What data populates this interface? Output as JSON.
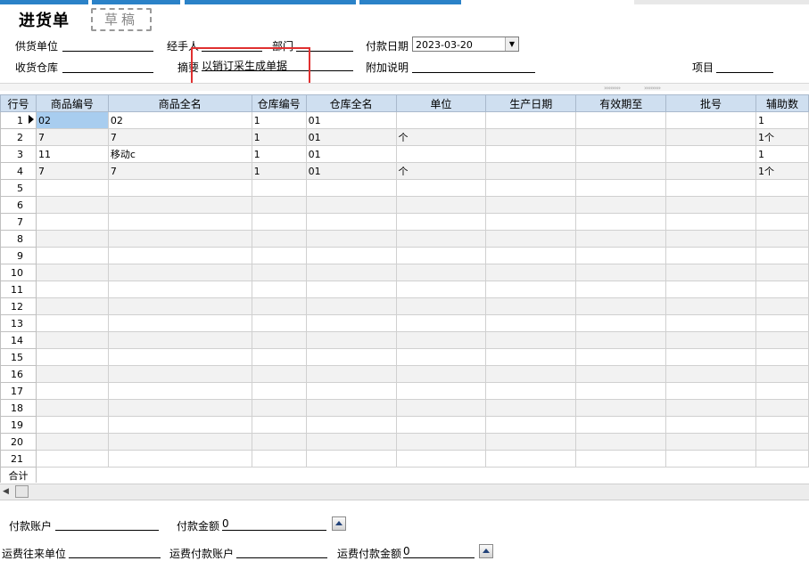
{
  "header": {
    "title": "进货单",
    "stamp": "草稿"
  },
  "form": {
    "supplier_label": "供货单位",
    "supplier_value": "",
    "handler_label": "经手人",
    "handler_value": "",
    "dept_label": "部门",
    "dept_value": "",
    "paydate_label": "付款日期",
    "paydate_value": "2023-03-20",
    "warehouse_label": "收货仓库",
    "warehouse_value": "",
    "summary_label": "摘要",
    "summary_value": "以销订采生成单据",
    "extra_label": "附加说明",
    "extra_value": "",
    "project_label": "项目",
    "project_value": ""
  },
  "grid": {
    "columns": [
      "行号",
      "商品编号",
      "商品全名",
      "仓库编号",
      "仓库全名",
      "单位",
      "生产日期",
      "有效期至",
      "批号",
      "辅助数"
    ],
    "rows": [
      {
        "no": "1",
        "code": "02",
        "name": "02",
        "wh_code": "1",
        "wh_name": "01",
        "unit": "",
        "mfg": "",
        "exp": "",
        "batch": "",
        "aux": "1"
      },
      {
        "no": "2",
        "code": "7",
        "name": "7",
        "wh_code": "1",
        "wh_name": "01",
        "unit": "个",
        "mfg": "",
        "exp": "",
        "batch": "",
        "aux": "1个"
      },
      {
        "no": "3",
        "code": "11",
        "name": "移动c",
        "wh_code": "1",
        "wh_name": "01",
        "unit": "",
        "mfg": "",
        "exp": "",
        "batch": "",
        "aux": "1"
      },
      {
        "no": "4",
        "code": "7",
        "name": "7",
        "wh_code": "1",
        "wh_name": "01",
        "unit": "个",
        "mfg": "",
        "exp": "",
        "batch": "",
        "aux": "1个"
      },
      {
        "no": "5"
      },
      {
        "no": "6"
      },
      {
        "no": "7"
      },
      {
        "no": "8"
      },
      {
        "no": "9"
      },
      {
        "no": "10"
      },
      {
        "no": "11"
      },
      {
        "no": "12"
      },
      {
        "no": "13"
      },
      {
        "no": "14"
      },
      {
        "no": "15"
      },
      {
        "no": "16"
      },
      {
        "no": "17"
      },
      {
        "no": "18"
      },
      {
        "no": "19"
      },
      {
        "no": "20"
      },
      {
        "no": "21"
      }
    ],
    "total_label": "合计"
  },
  "footer": {
    "pay_account_label": "付款账户",
    "pay_account_value": "",
    "pay_amount_label": "付款金额",
    "pay_amount_value": "0",
    "freight_unit_label": "运费往来单位",
    "freight_unit_value": "",
    "freight_account_label": "运费付款账户",
    "freight_account_value": "",
    "freight_amount_label": "运费付款金额",
    "freight_amount_value": "0"
  },
  "icons": {
    "row_pointer": "triangle-right-icon",
    "scroll_left": "arrow-left-icon",
    "expand": "triangle-up-icon"
  },
  "colors": {
    "header_bg": "#cfdff0",
    "selected_cell": "#a8cdef",
    "highlight_box": "#e03030",
    "tab_strip": "#2b82c8"
  }
}
